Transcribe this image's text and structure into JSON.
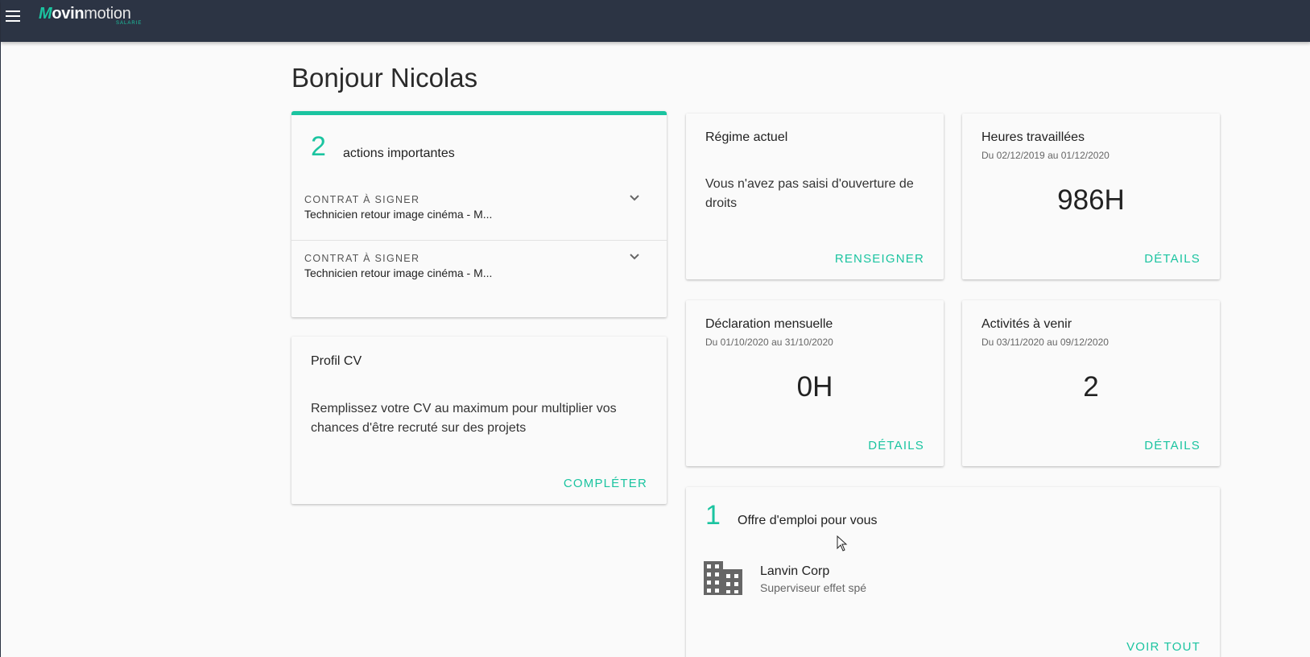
{
  "app": {
    "logo_prefix": "M",
    "logo_bold": "ovin",
    "logo_light": "motion",
    "logo_subtitle": "SALARIE"
  },
  "colors": {
    "accent": "#1bc4a0",
    "topbar": "#2c3444",
    "background": "#fafafa"
  },
  "greeting": "Bonjour Nicolas",
  "actions": {
    "count": "2",
    "label": "actions importantes",
    "items": [
      {
        "kind": "CONTRAT À SIGNER",
        "description": "Technicien retour image cinéma - M..."
      },
      {
        "kind": "CONTRAT À SIGNER",
        "description": "Technicien retour image cinéma - M..."
      }
    ]
  },
  "profile": {
    "title": "Profil CV",
    "body": "Remplissez votre CV au maximum pour multiplier vos chances d'être recruté sur des projets",
    "button": "COMPLÉTER"
  },
  "regime": {
    "title": "Régime actuel",
    "body": "Vous n'avez pas saisi d'ouverture de droits",
    "button": "RENSEIGNER"
  },
  "hours": {
    "title": "Heures travaillées",
    "period": "Du 02/12/2019 au 01/12/2020",
    "value": "986H",
    "button": "DÉTAILS"
  },
  "declaration": {
    "title": "Déclaration mensuelle",
    "period": "Du 01/10/2020 au 31/10/2020",
    "value": "0H",
    "button": "DÉTAILS"
  },
  "activities": {
    "title": "Activités à venir",
    "period": "Du 03/11/2020 au 09/12/2020",
    "value": "2",
    "button": "DÉTAILS"
  },
  "jobs": {
    "count": "1",
    "label": "Offre d'emploi pour vous",
    "items": [
      {
        "company": "Lanvin Corp",
        "role": "Superviseur effet spé",
        "icon": "building-icon"
      }
    ],
    "button": "VOIR TOUT"
  }
}
